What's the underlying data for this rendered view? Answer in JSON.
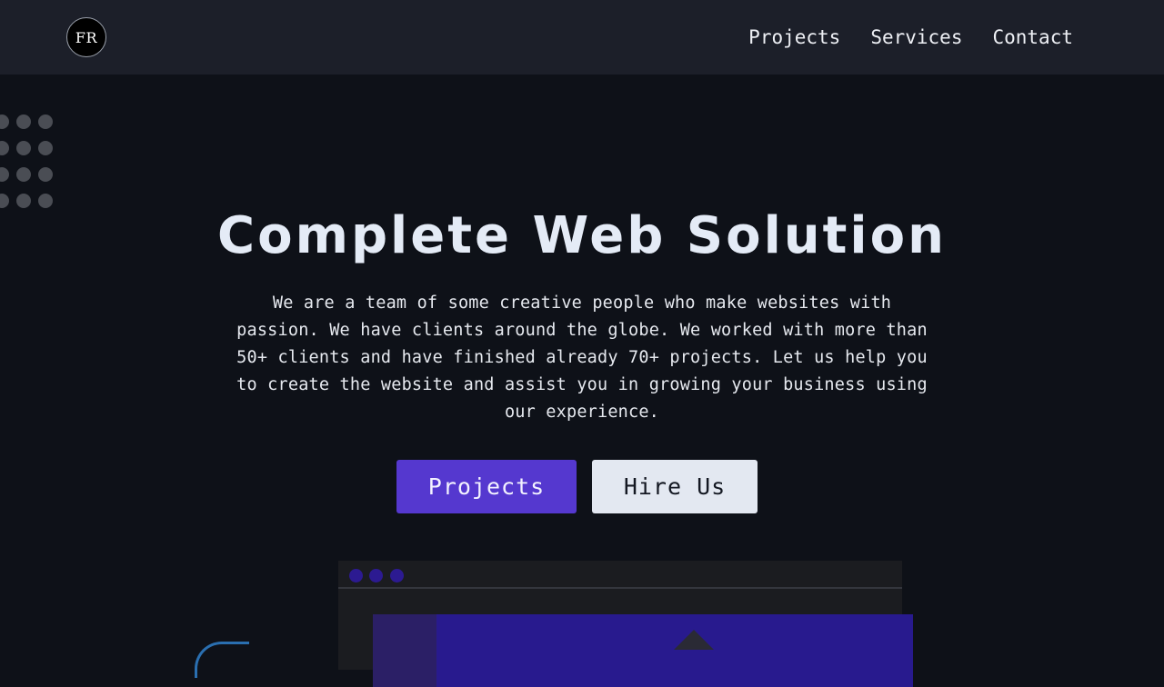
{
  "navbar": {
    "logo_text": "FR",
    "links": [
      {
        "label": "Projects"
      },
      {
        "label": "Services"
      },
      {
        "label": "Contact"
      }
    ]
  },
  "hero": {
    "title": "Complete Web Solution",
    "description": "We are a team of some creative people who make websites with passion. We have clients around the globe. We worked with more than 50+ clients and have finished already 70+ projects. Let us help you to create the website and assist you in growing your business using our experience.",
    "primary_button": "Projects",
    "secondary_button": "Hire Us"
  },
  "colors": {
    "background": "#0e1118",
    "navbar": "#1c1f29",
    "accent": "#5538cf",
    "secondary_button": "#e3e8f1"
  }
}
